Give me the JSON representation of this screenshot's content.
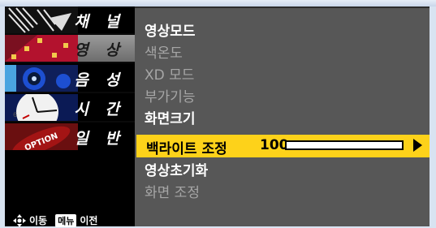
{
  "sidebar": {
    "items": [
      {
        "label": "채 널",
        "active": false,
        "icon": "channel-icon"
      },
      {
        "label": "영 상",
        "active": true,
        "icon": "picture-icon"
      },
      {
        "label": "음 성",
        "active": false,
        "icon": "sound-icon"
      },
      {
        "label": "시 간",
        "active": false,
        "icon": "clock-icon"
      },
      {
        "label": "일 반",
        "active": false,
        "icon": "option-icon"
      }
    ],
    "option_badge": "OPTION",
    "hint": {
      "move": "이동",
      "menu_key": "메뉴",
      "prev": "이전"
    }
  },
  "menu": {
    "items": [
      {
        "label": "영상모드",
        "enabled": true
      },
      {
        "label": "색온도",
        "enabled": false
      },
      {
        "label": "XD 모드",
        "enabled": false
      },
      {
        "label": "부가기능",
        "enabled": false
      },
      {
        "label": "화면크기",
        "enabled": true
      },
      {
        "label": "백라이트 조정",
        "enabled": true,
        "selected": true,
        "value": "100"
      },
      {
        "label": "영상초기화",
        "enabled": true
      },
      {
        "label": "화면 조정",
        "enabled": false
      }
    ],
    "backlight": {
      "label": "백라이트 조정",
      "value": "100",
      "level": 1.0
    }
  },
  "colors": {
    "highlight": "#fdd21a",
    "panel": "#575757",
    "sidebar": "#000000",
    "frame": "#d8e3f1"
  }
}
